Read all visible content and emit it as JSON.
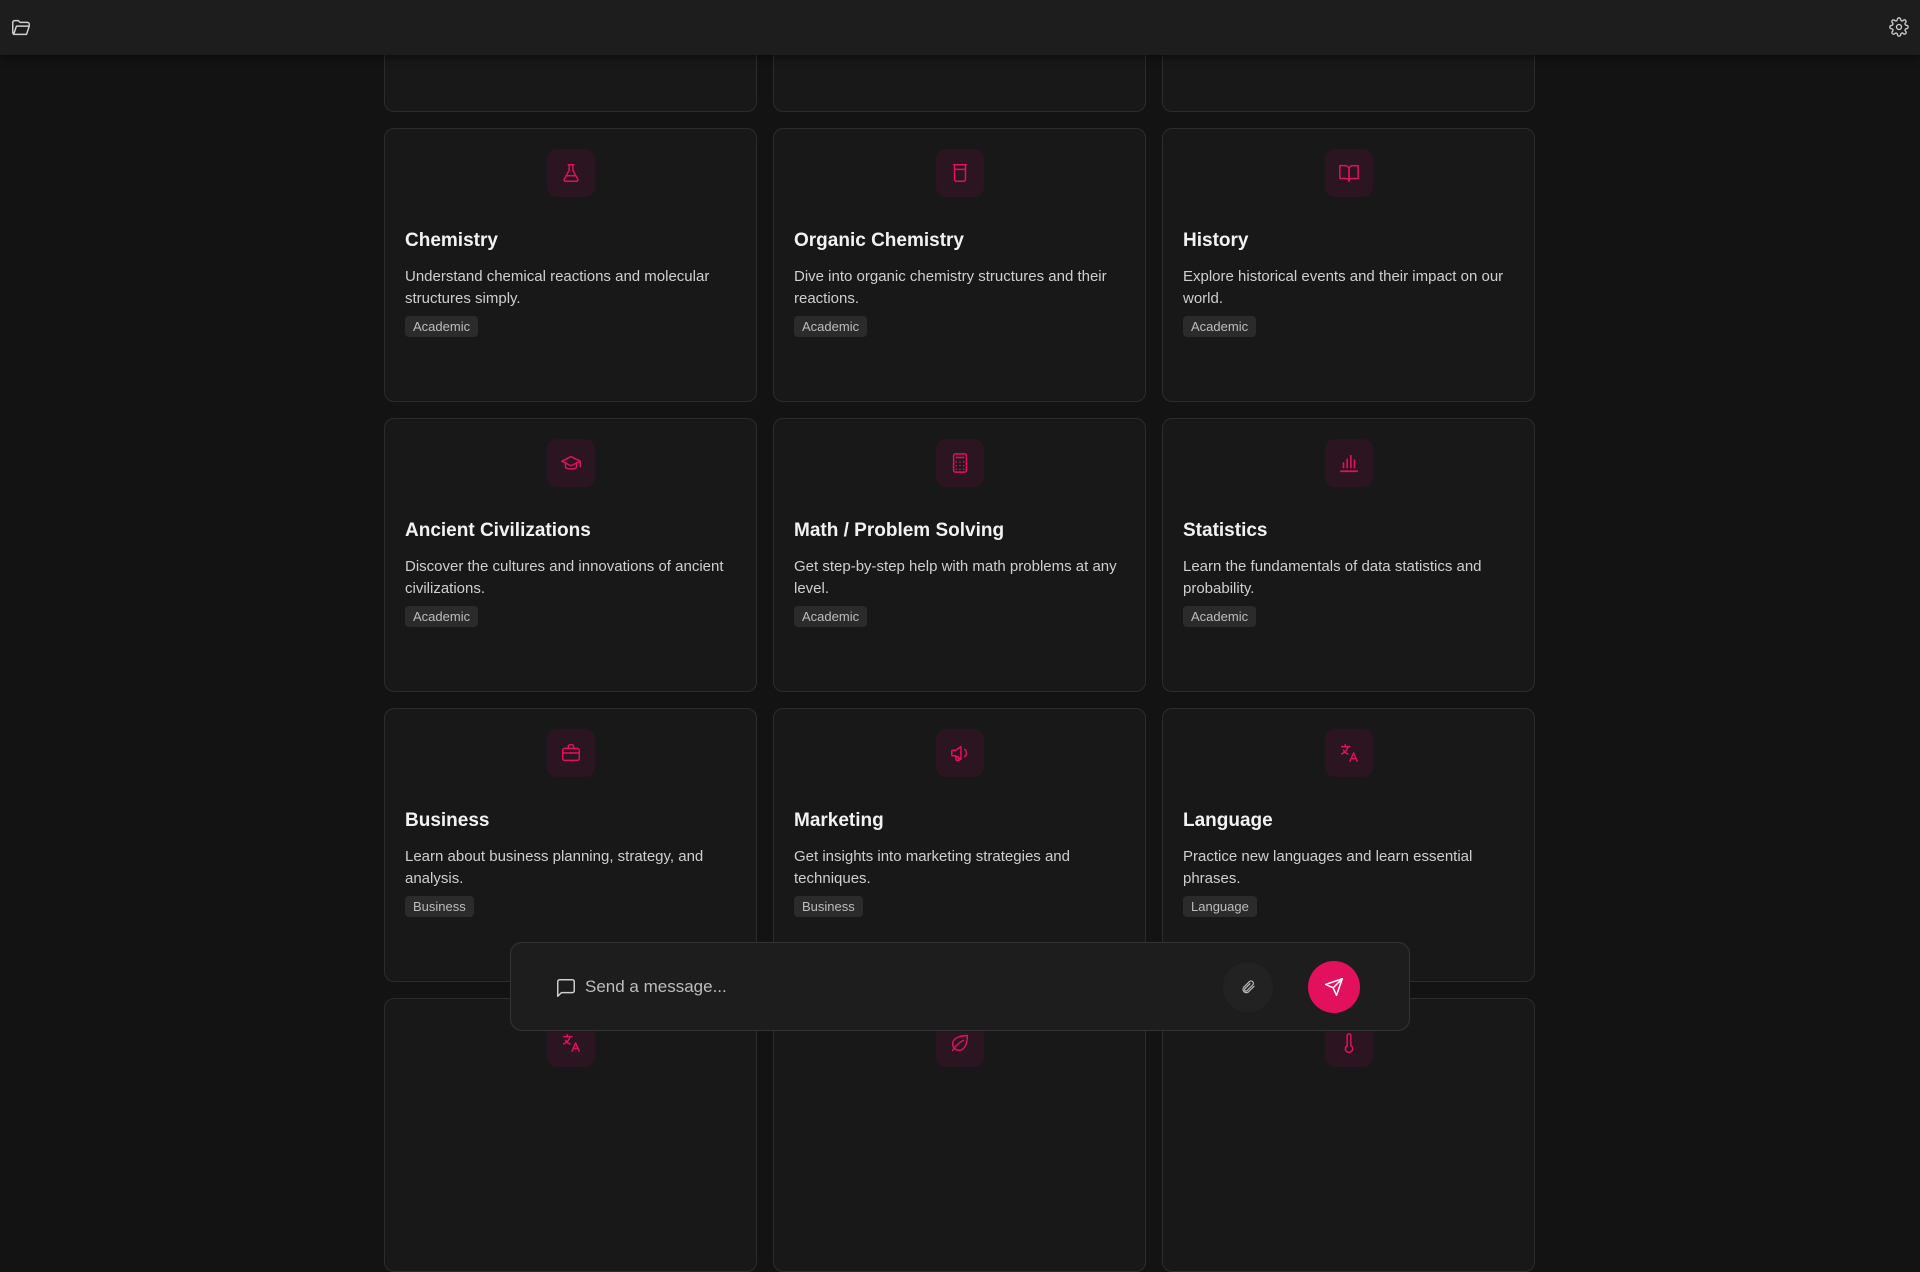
{
  "colors": {
    "accent": "#e3105e",
    "background": "#131313",
    "card": "#181818"
  },
  "topbar": {
    "folder_icon": "folder-icon",
    "settings_icon": "gear-icon"
  },
  "cards": [
    {
      "title": "Chemistry",
      "description": "Understand chemical reactions and molecular structures simply.",
      "tag": "Academic",
      "icon": "flask-icon"
    },
    {
      "title": "Organic Chemistry",
      "description": "Dive into organic chemistry structures and their reactions.",
      "tag": "Academic",
      "icon": "beaker-icon"
    },
    {
      "title": "History",
      "description": "Explore historical events and their impact on our world.",
      "tag": "Academic",
      "icon": "book-open-icon"
    },
    {
      "title": "Ancient Civilizations",
      "description": "Discover the cultures and innovations of ancient civilizations.",
      "tag": "Academic",
      "icon": "graduation-cap-icon"
    },
    {
      "title": "Math / Problem Solving",
      "description": "Get step-by-step help with math problems at any level.",
      "tag": "Academic",
      "icon": "calculator-icon"
    },
    {
      "title": "Statistics",
      "description": "Learn the fundamentals of data statistics and probability.",
      "tag": "Academic",
      "icon": "bar-chart-icon"
    },
    {
      "title": "Business",
      "description": "Learn about business planning, strategy, and analysis.",
      "tag": "Business",
      "icon": "briefcase-icon"
    },
    {
      "title": "Marketing",
      "description": "Get insights into marketing strategies and techniques.",
      "tag": "Business",
      "icon": "megaphone-icon"
    },
    {
      "title": "Language",
      "description": "Practice new languages and learn essential phrases.",
      "tag": "Language",
      "icon": "translate-icon"
    }
  ],
  "partial_cards_bottom": [
    {
      "icon": "translate-icon"
    },
    {
      "icon": "leaf-icon"
    },
    {
      "icon": "thermometer-icon"
    }
  ],
  "composer": {
    "placeholder": "Send a message...",
    "chat_icon": "message-square-icon",
    "attach_icon": "paperclip-icon",
    "send_icon": "send-icon"
  }
}
